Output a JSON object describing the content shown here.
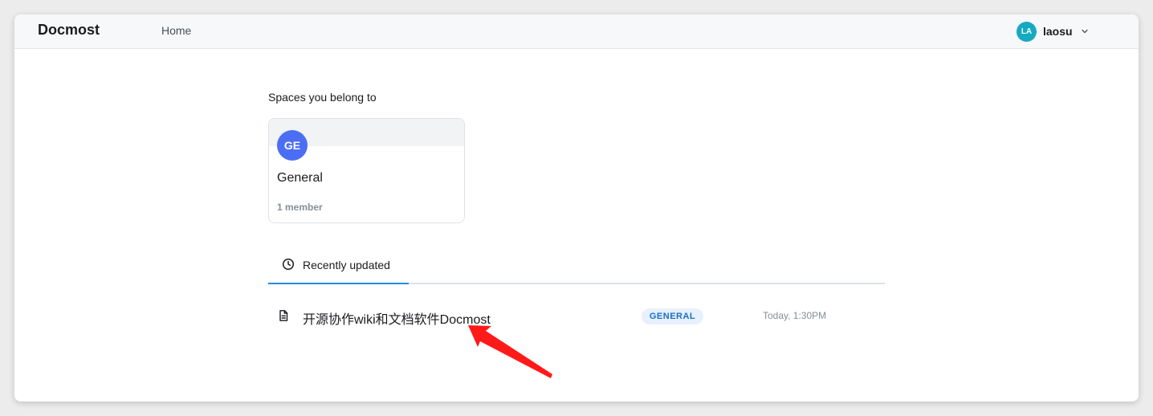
{
  "header": {
    "brand": "Docmost",
    "nav": {
      "home": "Home"
    },
    "user": {
      "initials": "LA",
      "name": "laosu",
      "avatar_color": "#15aabf"
    }
  },
  "spaces": {
    "section_title": "Spaces you belong to",
    "items": [
      {
        "initials": "GE",
        "name": "General",
        "members": "1 member",
        "avatar_color": "#4c6ef5"
      }
    ]
  },
  "tabs": {
    "recent": {
      "label": "Recently updated",
      "icon": "clock-icon"
    }
  },
  "recent_pages": [
    {
      "icon": "file-text-icon",
      "title": "开源协作wiki和文档软件Docmost",
      "space": "GENERAL",
      "updated": "Today, 1:30PM"
    }
  ],
  "colors": {
    "accent": "#228be6",
    "badge_bg": "#e7f0fc",
    "badge_text": "#1971c2",
    "annotation_arrow": "#ff1a1a"
  }
}
